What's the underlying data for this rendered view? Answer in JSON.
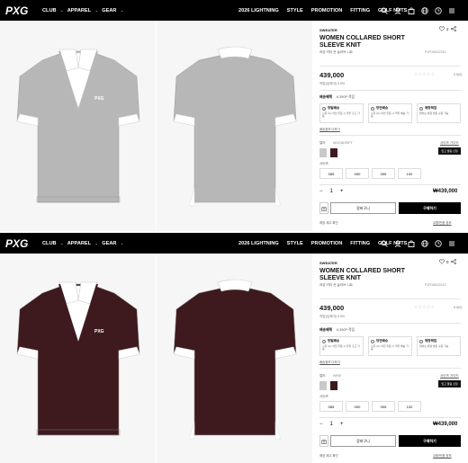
{
  "screens": [
    {
      "nav": {
        "logo": "PXG",
        "left": [
          "CLUB",
          "APPAREL",
          "GEAR"
        ],
        "right": [
          "2026 LIGHTNING",
          "STYLE",
          "PROMOTION",
          "FITTING",
          "GOLF NUTS"
        ]
      },
      "product": {
        "category": "SWEATER",
        "wishlist_count": "2",
        "title": "WOMEN COLLARED SHORT SLEEVE KNIT",
        "subtitle": "여성 카라 숏 슬리브 니트",
        "code": "PJFDK612312",
        "price": "439,000",
        "rating_stars": "☆☆☆☆☆",
        "rating_score": "0.0(0)",
        "points": "적립금(최대) 0.5%",
        "benefit_label": "배송혜택",
        "benefit_value": "6,390P 적립",
        "shipping": [
          {
            "title": "당일배송",
            "desc": "오후 3시 이전 주문 시 당일 출고 가능"
          },
          {
            "title": "당연배송",
            "desc": "오후 2시 이전 주문 시 익일 배송 가능"
          },
          {
            "title": "매장픽업",
            "desc": "원하는 매장 방문 수령 가능"
          }
        ],
        "more_link": "배송정보 더보기",
        "color_label": "컬러",
        "color_value": "MOONDRIFT",
        "size_guide": "사이즈 가이드",
        "notify": "입고 알림 신청",
        "size_label": "사이즈",
        "sizes": [
          "085",
          "090",
          "095",
          "100"
        ],
        "qty": "1",
        "qty_minus": "−",
        "qty_plus": "+",
        "total": "₩439,000",
        "cart": "장바구니",
        "buy": "구매하기",
        "store": "매장 재고 확인",
        "return": "교환/반품 정보"
      },
      "colors": {
        "swatch_a": "#c9c9c9",
        "swatch_b": "#3e1a1e",
        "body": "#b7b7b7"
      }
    },
    {
      "nav": {
        "logo": "PXG",
        "left": [
          "CLUB",
          "APPAREL",
          "GEAR"
        ],
        "right": [
          "2026 LIGHTNING",
          "STYLE",
          "PROMOTION",
          "FITTING",
          "GOLF NUTS"
        ]
      },
      "product": {
        "category": "SWEATER",
        "wishlist_count": "0",
        "title": "WOMEN COLLARED SHORT SLEEVE KNIT",
        "subtitle": "여성 카라 숏 슬리브 니트",
        "code": "PJFDK612312",
        "price": "439,000",
        "rating_stars": "☆☆☆☆☆",
        "rating_score": "0.0(0)",
        "points": "적립금(최대) 0.5%",
        "benefit_label": "배송혜택",
        "benefit_value": "6,390P 적립",
        "shipping": [
          {
            "title": "당일배송",
            "desc": "오후 3시 이전 주문 시 당일 출고 가능"
          },
          {
            "title": "당연배송",
            "desc": "오후 2시 이전 주문 시 익일 배송 가능"
          },
          {
            "title": "매장픽업",
            "desc": "원하는 매장 방문 수령 가능"
          }
        ],
        "more_link": "배송정보 더보기",
        "color_label": "컬러",
        "color_value": "WINE",
        "size_guide": "사이즈 가이드",
        "notify": "입고 알림 신청",
        "size_label": "사이즈",
        "sizes": [
          "085",
          "090",
          "095",
          "100"
        ],
        "qty": "1",
        "qty_minus": "−",
        "qty_plus": "+",
        "total": "₩439,000",
        "cart": "장바구니",
        "buy": "구매하기",
        "store": "매장 재고 확인",
        "return": "교환/반품 정보"
      },
      "colors": {
        "swatch_a": "#c9c9c9",
        "swatch_b": "#3e1a1e",
        "body": "#3e1a1e"
      }
    }
  ]
}
